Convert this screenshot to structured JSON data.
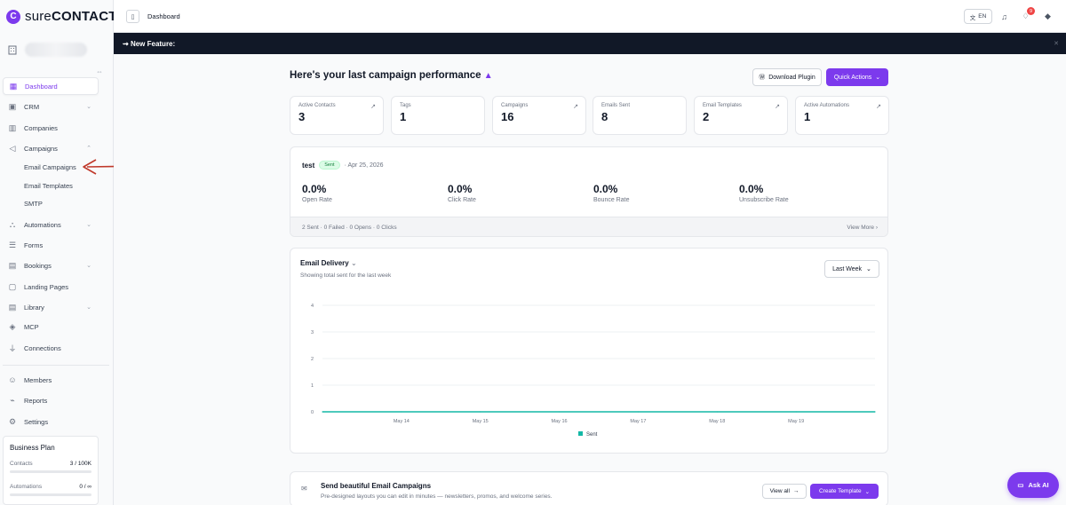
{
  "brand": {
    "name_prefix": "sure",
    "name_suffix": "CONTACT",
    "accent": "#7c3aed"
  },
  "sidebar": {
    "items": [
      {
        "label": "Dashboard",
        "icon": "grid-icon",
        "active": true
      },
      {
        "label": "CRM",
        "icon": "crm-icon"
      },
      {
        "label": "Companies",
        "icon": "building-icon"
      },
      {
        "label": "Campaigns",
        "icon": "megaphone-icon"
      },
      {
        "label": "Automations",
        "icon": "flow-icon"
      },
      {
        "label": "Forms",
        "icon": "form-icon"
      },
      {
        "label": "Bookings",
        "icon": "calendar-icon"
      },
      {
        "label": "Landing Pages",
        "icon": "layout-icon"
      },
      {
        "label": "Library",
        "icon": "library-icon"
      },
      {
        "label": "MCP",
        "icon": "mcp-icon"
      },
      {
        "label": "Connections",
        "icon": "plug-icon"
      },
      {
        "label": "Members",
        "icon": "members-icon"
      },
      {
        "label": "Reports",
        "icon": "chart-icon"
      },
      {
        "label": "Settings",
        "icon": "gear-icon"
      }
    ],
    "campaign_subitems": [
      "Email Campaigns",
      "Email Templates",
      "SMTP"
    ],
    "plan": {
      "title": "Business Plan",
      "contacts_label": "Contacts",
      "contacts_value": "3 / 100K",
      "automations_label": "Automations",
      "automations_value": "0 / ∞"
    }
  },
  "topbar": {
    "breadcrumb": "Dashboard",
    "language": "EN",
    "notifications": "9"
  },
  "feature_bar": {
    "label": "New Feature:"
  },
  "dashboard": {
    "title": "Here's your last campaign performance",
    "download_label": "Download Plugin",
    "quick_actions_label": "Quick Actions",
    "stats": [
      {
        "label": "Active Contacts",
        "value": "3"
      },
      {
        "label": "Tags",
        "value": "1"
      },
      {
        "label": "Campaigns",
        "value": "16"
      },
      {
        "label": "Emails Sent",
        "value": "8"
      },
      {
        "label": "Email Templates",
        "value": "2"
      },
      {
        "label": "Active Automations",
        "value": "1"
      }
    ],
    "campaign": {
      "name": "test",
      "status": "Sent",
      "date": "· Apr 25, 2026",
      "metrics": [
        {
          "value": "0.0%",
          "label": "Open Rate"
        },
        {
          "value": "0.0%",
          "label": "Click Rate"
        },
        {
          "value": "0.0%",
          "label": "Bounce Rate"
        },
        {
          "value": "0.0%",
          "label": "Unsubscribe Rate"
        }
      ],
      "footer": "2 Sent · 0 Failed · 0 Opens · 0 Clicks",
      "view_more": "View More"
    },
    "templates_promo": {
      "title": "Send beautiful Email Campaigns",
      "subtitle": "Pre-designed layouts you can edit in minutes — newsletters, promos, and welcome series.",
      "view_all": "View all",
      "create": "Create Template"
    },
    "ask_ai": "Ask AI"
  },
  "chart_data": {
    "type": "area",
    "title": "Email Delivery",
    "subtitle": "Showing total sent for the last week",
    "range_label": "Last Week",
    "categories": [
      "",
      "May 14",
      "May 15",
      "May 16",
      "May 17",
      "May 18",
      "May 19",
      ""
    ],
    "series": [
      {
        "name": "Sent",
        "values": [
          0,
          0,
          0,
          0,
          0,
          0,
          0,
          0
        ],
        "color": "#14b8a6"
      }
    ],
    "yticks": [
      0,
      1,
      2,
      3,
      4
    ],
    "ylim": [
      0,
      4
    ],
    "grid": true,
    "legend": "bottom"
  }
}
